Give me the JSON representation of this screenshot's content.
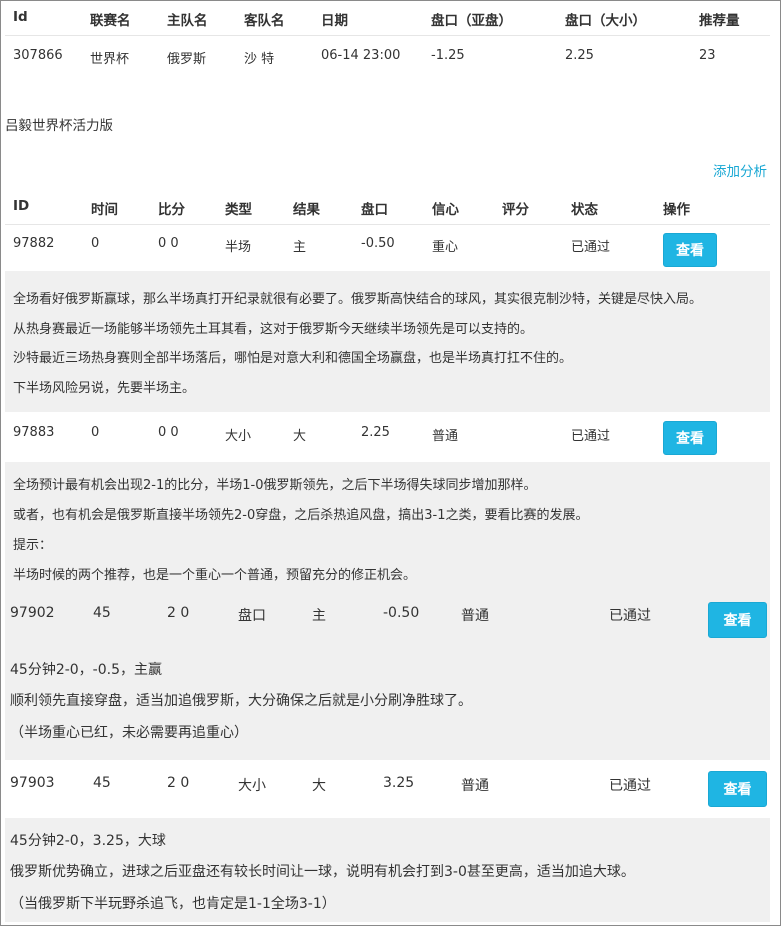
{
  "match_table": {
    "headers": [
      "Id",
      "联赛名",
      "主队名",
      "客队名",
      "日期",
      "盘口（亚盘）",
      "盘口（大小）",
      "推荐量"
    ],
    "row": [
      "307866",
      "世界杯",
      "俄罗斯",
      "沙 特",
      "06-14 23:00",
      "-1.25",
      "2.25",
      "23"
    ]
  },
  "author": "吕毅世界杯活力版",
  "add_analysis_label": "添加分析",
  "analysis_table": {
    "headers": [
      "ID",
      "时间",
      "比分",
      "类型",
      "结果",
      "盘口",
      "信心",
      "评分",
      "状态",
      "操作"
    ],
    "view_label": "查看",
    "rows": [
      {
        "id": "97882",
        "time": "0",
        "score": "0 0",
        "type": "半场",
        "result": "主",
        "line": "-0.50",
        "confidence": "重心",
        "rating": "",
        "status": "已通过",
        "notes": [
          "全场看好俄罗斯赢球，那么半场真打开纪录就很有必要了。俄罗斯高快结合的球风，其实很克制沙特，关键是尽快入局。",
          "从热身赛最近一场能够半场领先土耳其看，这对于俄罗斯今天继续半场领先是可以支持的。",
          "沙特最近三场热身赛则全部半场落后，哪怕是对意大利和德国全场赢盘，也是半场真打扛不住的。",
          "下半场风险另说，先要半场主。"
        ]
      },
      {
        "id": "97883",
        "time": "0",
        "score": "0 0",
        "type": "大小",
        "result": "大",
        "line": "2.25",
        "confidence": "普通",
        "rating": "",
        "status": "已通过",
        "notes": [
          "全场预计最有机会出现2-1的比分，半场1-0俄罗斯领先，之后下半场得失球同步增加那样。",
          "或者，也有机会是俄罗斯直接半场领先2-0穿盘，之后杀热追风盘，搞出3-1之类，要看比赛的发展。",
          "提示：",
          "半场时候的两个推荐，也是一个重心一个普通，预留充分的修正机会。"
        ]
      },
      {
        "id": "97902",
        "time": "45",
        "score": "2 0",
        "type": "盘口",
        "result": "主",
        "line": "-0.50",
        "confidence": "普通",
        "rating": "",
        "status": "已通过",
        "notes": [
          "45分钟2-0，-0.5，主赢",
          "顺利领先直接穿盘，适当加追俄罗斯，大分确保之后就是小分刷净胜球了。",
          "（半场重心已红，未必需要再追重心）"
        ]
      },
      {
        "id": "97903",
        "time": "45",
        "score": "2 0",
        "type": "大小",
        "result": "大",
        "line": "3.25",
        "confidence": "普通",
        "rating": "",
        "status": "已通过",
        "notes": [
          "45分钟2-0，3.25，大球",
          "俄罗斯优势确立，进球之后亚盘还有较长时间让一球，说明有机会打到3-0甚至更高，适当加追大球。",
          "（当俄罗斯下半玩野杀追飞，也肯定是1-1全场3-1）"
        ]
      }
    ]
  }
}
